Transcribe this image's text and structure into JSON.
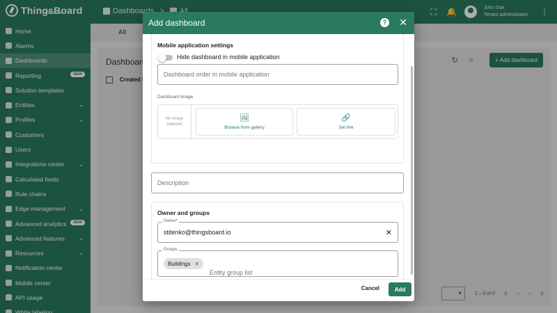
{
  "app": {
    "logo": "ThingsBoard",
    "logo_sub": "Professional"
  },
  "breadcrumb": {
    "first": "Dashboards",
    "sep": ">",
    "second": "All"
  },
  "user": {
    "name": "John Doe",
    "role": "Tenant administrator"
  },
  "sidebar": {
    "items": [
      {
        "label": "Home"
      },
      {
        "label": "Alarms"
      },
      {
        "label": "Dashboards",
        "active": true
      },
      {
        "label": "Reporting",
        "badge": "NEW"
      },
      {
        "label": "Solution templates"
      },
      {
        "label": "Entities",
        "chevron": "⌄"
      },
      {
        "label": "Profiles",
        "chevron": "⌄"
      },
      {
        "label": "Customers"
      },
      {
        "label": "Users"
      },
      {
        "label": "Integrations center",
        "chevron": "⌄"
      },
      {
        "label": "Calculated fields"
      },
      {
        "label": "Rule chains"
      },
      {
        "label": "Edge management",
        "chevron": "⌄"
      },
      {
        "label": "Advanced analytics",
        "badge": "NEW"
      },
      {
        "label": "Advanced features",
        "chevron": "⌄"
      },
      {
        "label": "Resources",
        "chevron": "⌄"
      },
      {
        "label": "Notification center"
      },
      {
        "label": "Mobile center"
      },
      {
        "label": "API usage"
      },
      {
        "label": "White labeling"
      }
    ]
  },
  "main": {
    "tab_all": "All",
    "card_title": "Dashboards",
    "col_created": "Created ti",
    "add_button": "+ Add dashboard",
    "pager_range": "1 – 0 of 0"
  },
  "dialog": {
    "title": "Add dashboard",
    "mobile_section_title": "Mobile application settings",
    "hide_toggle_label": "Hide dashboard in mobile application",
    "order_placeholder": "Dashboard order in mobile application",
    "image_label": "Dashboard image",
    "no_image": "No image selected",
    "browse_gallery": "Browse from gallery",
    "set_link": "Set link",
    "description_placeholder": "Description",
    "owner_section_title": "Owner and groups",
    "owner_label": "Owner*",
    "owner_value": "stitenko@thingsboard.io",
    "groups_label": "Groups",
    "group_chip": "Buildings",
    "groups_placeholder": "Entity group list",
    "cancel": "Cancel",
    "add": "Add"
  },
  "colors": {
    "primary": "#2a7a5f"
  }
}
